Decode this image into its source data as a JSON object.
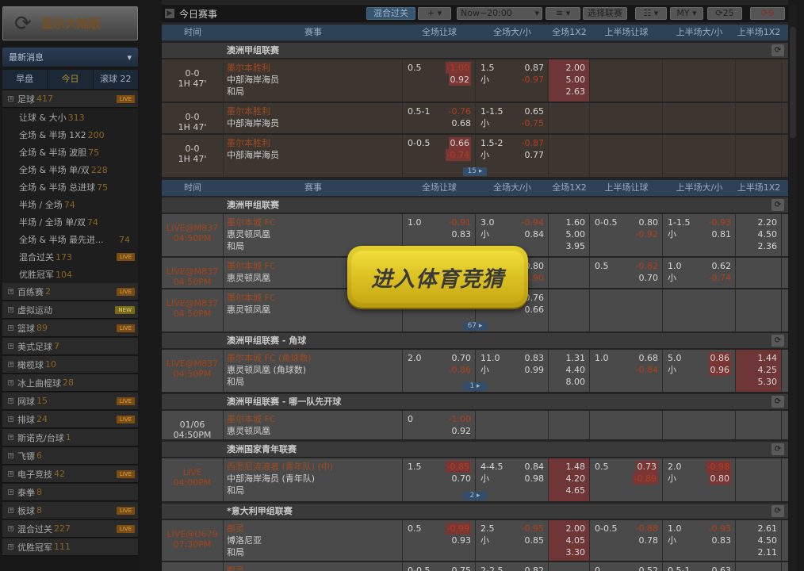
{
  "sidebar": {
    "brand_label": "显示大陆版",
    "news_label": "最新消息",
    "tabs": [
      "早盘",
      "今日",
      "滚球 22"
    ],
    "sports": [
      {
        "name": "足球",
        "count": "417",
        "tag": "LIVE"
      },
      {
        "name": "百练赛",
        "count": "2",
        "tag": "LIVE"
      },
      {
        "name": "虚拟运动",
        "count": "",
        "tag": "NEW"
      },
      {
        "name": "篮球",
        "count": "89",
        "tag": "LIVE"
      },
      {
        "name": "美式足球",
        "count": "7",
        "tag": ""
      },
      {
        "name": "橄榄球",
        "count": "10",
        "tag": ""
      },
      {
        "name": "冰上曲棍球",
        "count": "28",
        "tag": ""
      },
      {
        "name": "网球",
        "count": "15",
        "tag": "LIVE"
      },
      {
        "name": "排球",
        "count": "24",
        "tag": "LIVE"
      },
      {
        "name": "斯诺克/台球",
        "count": "1",
        "tag": ""
      },
      {
        "name": "飞镖",
        "count": "6",
        "tag": ""
      },
      {
        "name": "电子竞技",
        "count": "42",
        "tag": "LIVE"
      },
      {
        "name": "泰拳",
        "count": "8",
        "tag": ""
      },
      {
        "name": "板球",
        "count": "8",
        "tag": "LIVE"
      },
      {
        "name": "混合过关",
        "count": "227",
        "tag": "LIVE"
      },
      {
        "name": "优胜冠军",
        "count": "111",
        "tag": ""
      }
    ],
    "football_sub": [
      {
        "name": "让球 & 大小",
        "count": "313",
        "tag": ""
      },
      {
        "name": "全场 & 半场 1X2",
        "count": "200",
        "tag": ""
      },
      {
        "name": "全场 & 半场 波胆",
        "count": "75",
        "tag": ""
      },
      {
        "name": "全场 & 半场 单/双",
        "count": "228",
        "tag": ""
      },
      {
        "name": "全场 & 半场 总进球",
        "count": "75",
        "tag": ""
      },
      {
        "name": "半场 / 全场",
        "count": "74",
        "tag": ""
      },
      {
        "name": "半场 / 全场 单/双",
        "count": "74",
        "tag": ""
      },
      {
        "name": "全场 & 半场 最先进...",
        "count": "74",
        "tag": ""
      },
      {
        "name": "混合过关",
        "count": "173",
        "tag": "LIVE"
      },
      {
        "name": "优胜冠军",
        "count": "104",
        "tag": ""
      }
    ]
  },
  "toolbar": {
    "title": "今日赛事",
    "parlay": "混合过关",
    "add": "+",
    "time_range": "Now~20:00",
    "select_league": "选择联赛",
    "odds_type": "MY",
    "refresh1": "25",
    "refresh2": "9"
  },
  "headers": [
    "时间",
    "赛事",
    "全场让球",
    "全场大/小",
    "全场1X2",
    "上半场让球",
    "上半场大/小",
    "上半场1X2"
  ],
  "promo_label": "进入体育竞猜",
  "leagues": {
    "l1": "澳洲甲组联赛",
    "l2": "澳洲甲组联赛",
    "l3": "澳洲甲组联赛 - 角球",
    "l4": "澳洲甲组联赛 - 哪一队先开球",
    "l5": "澳洲国家青年联赛",
    "l6": "*意大利甲组联赛"
  },
  "matches": {
    "m1": {
      "t1": "0-0",
      "t2": "1H 47'",
      "home": "墨尔本胜利",
      "away": "中部海岸海员",
      "draw": "和局",
      "hcp": "0.5",
      "h1": "-1.00",
      "h2": "0.92",
      "ou": "1.5",
      "ou_u": "小",
      "o1": "0.87",
      "o2": "-0.97",
      "x1": "2.00",
      "x2": "5.00",
      "x3": "2.63"
    },
    "m2": {
      "t1": "0-0",
      "t2": "1H 47'",
      "home": "墨尔本胜利",
      "away": "中部海岸海员",
      "hcp": "0.5-1",
      "h1": "-0.76",
      "h2": "0.68",
      "ou": "1-1.5",
      "ou_u": "小",
      "o1": "0.65",
      "o2": "-0.75"
    },
    "m3": {
      "t1": "0-0",
      "t2": "1H 47'",
      "home": "墨尔本胜利",
      "away": "中部海岸海员",
      "hcp": "0-0.5",
      "h1": "0.66",
      "h2": "-0.74",
      "ou": "1.5-2",
      "ou_u": "小",
      "o1": "-0.87",
      "o2": "0.77",
      "more": "15"
    },
    "m4": {
      "t1": "LIVE@M837",
      "t2": "04:50PM",
      "home": "墨尔本城 FC",
      "away": "惠灵顿凤凰",
      "draw": "和局",
      "hcp": "1.0",
      "h1": "-0.91",
      "h2": "0.83",
      "ou": "3.0",
      "ou_u": "小",
      "o1": "-0.94",
      "o2": "0.84",
      "x1": "1.60",
      "x2": "5.00",
      "x3": "3.95",
      "fh": "0-0.5",
      "f1": "0.80",
      "f2": "-0.92",
      "fo": "1-1.5",
      "fou": "小",
      "fo1": "-0.93",
      "fo2": "0.81",
      "fx1": "2.20",
      "fx2": "4.50",
      "fx3": "2.36"
    },
    "m5": {
      "t1": "LIVE@M837",
      "t2": "04:50PM",
      "home": "墨尔本城 FC",
      "away": "惠灵顿凤凰",
      "o1": "0.80",
      "o2": "-0.90",
      "fh": "0.5",
      "f1": "-0.82",
      "f2": "0.70",
      "fo": "1.0",
      "fou": "小",
      "fo1": "0.62",
      "fo2": "-0.74"
    },
    "m6": {
      "t1": "LIVE@M837",
      "t2": "04:50PM",
      "home": "墨尔本城 FC",
      "away": "惠灵顿凤凰",
      "o1": "0.76",
      "o2": "0.66",
      "h2": "0.82",
      "more": "67"
    },
    "m7": {
      "t1": "LIVE@M837",
      "t2": "04:50PM",
      "home": "墨尔本城 FC (角球数)",
      "away": "惠灵顿凤凰 (角球数)",
      "draw": "和局",
      "hcp": "2.0",
      "h1": "0.70",
      "h2": "-0.86",
      "ou": "11.0",
      "ou_u": "小",
      "o1": "0.83",
      "o2": "0.99",
      "x1": "1.31",
      "x2": "4.40",
      "x3": "8.00",
      "fh": "1.0",
      "f1": "0.68",
      "f2": "-0.84",
      "fo": "5.0",
      "fou": "小",
      "fo1": "0.86",
      "fo2": "0.96",
      "fx1": "1.44",
      "fx2": "4.25",
      "fx3": "5.30",
      "more": "1"
    },
    "m8": {
      "t1": "01/06",
      "t2": "04:50PM",
      "home": "墨尔本城 FC",
      "away": "惠灵顿凤凰",
      "hcp": "0",
      "h1": "-1.00",
      "h2": "0.92"
    },
    "m9": {
      "t1": "LIVE",
      "t2": "04:00PM",
      "home": "西悉尼流浪者 (青年队) (中)",
      "away": "中部海岸海员 (青年队)",
      "draw": "和局",
      "hcp": "1.5",
      "h1": "-0.85",
      "h2": "0.70",
      "ou": "4-4.5",
      "ou_u": "小",
      "o1": "0.84",
      "o2": "0.98",
      "x1": "1.48",
      "x2": "4.20",
      "x3": "4.65",
      "fh": "0.5",
      "f1": "0.73",
      "f2": "-0.89",
      "fo": "2.0",
      "fou": "小",
      "fo1": "-0.98",
      "fo2": "0.80",
      "more": "2"
    },
    "m10": {
      "t1": "LIVE@U679",
      "t2": "07:30PM",
      "home": "都灵",
      "away": "博洛尼亚",
      "draw": "和局",
      "hcp": "0.5",
      "h1": "-0.99",
      "h2": "0.93",
      "ou": "2.5",
      "ou_u": "小",
      "o1": "-0.95",
      "o2": "0.85",
      "x1": "2.00",
      "x2": "4.05",
      "x3": "3.30",
      "fh": "0-0.5",
      "f1": "-0.88",
      "f2": "0.78",
      "fo": "1.0",
      "fou": "小",
      "fo1": "-0.93",
      "fo2": "0.83",
      "fx1": "2.61",
      "fx2": "4.50",
      "fx3": "2.11"
    },
    "m11": {
      "t1": "LIVE@U679",
      "home": "都灵",
      "hcp": "0-0.5",
      "h1": "0.75",
      "ou": "2-2.5",
      "o1": "0.82",
      "fh": "0",
      "f1": "0.52",
      "fo": "0.5-1",
      "fo1": "0.63"
    }
  }
}
